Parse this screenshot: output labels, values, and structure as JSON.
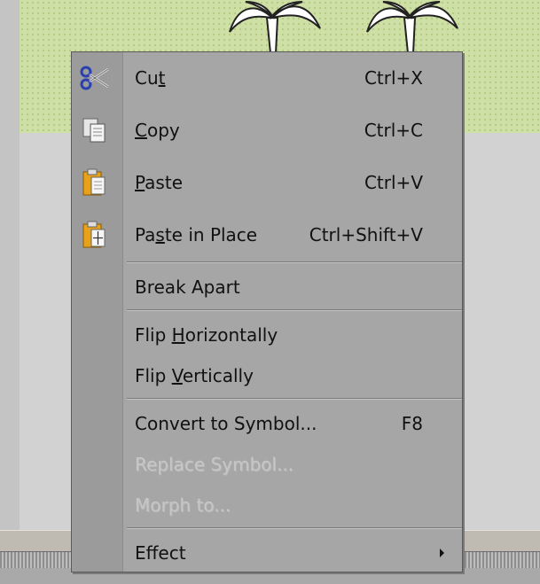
{
  "context_menu": {
    "cut": {
      "pre": "Cu",
      "key": "t",
      "post": "",
      "shortcut": "Ctrl+X"
    },
    "copy": {
      "pre": "",
      "key": "C",
      "post": "opy",
      "shortcut": "Ctrl+C"
    },
    "paste": {
      "pre": "",
      "key": "P",
      "post": "aste",
      "shortcut": "Ctrl+V"
    },
    "paste_in_place": {
      "pre": "Pa",
      "key": "s",
      "post": "te in Place",
      "shortcut": "Ctrl+Shift+V"
    },
    "break_apart": {
      "label": "Break Apart"
    },
    "flip_horizontally": {
      "pre": "Flip ",
      "key": "H",
      "post": "orizontally"
    },
    "flip_vertically": {
      "pre": "Flip ",
      "key": "V",
      "post": "ertically"
    },
    "convert_to_symbol": {
      "label": "Convert to Symbol...",
      "shortcut": "F8"
    },
    "replace_symbol": {
      "label": "Replace Symbol...",
      "enabled": false
    },
    "morph_to": {
      "label": "Morph to...",
      "enabled": false
    },
    "effect": {
      "label": "Effect",
      "has_submenu": true
    }
  },
  "icons": {
    "cut": "scissors-icon",
    "copy": "copy-icon",
    "paste": "paste-icon",
    "paste_in_place": "paste-in-place-icon"
  },
  "colors": {
    "canvas": "#cfe0a7",
    "menu_bg": "#a6a6a6",
    "menu_gutter": "#9b9b9b",
    "scissors": "#2a3fb0",
    "clipboard": "#e8a21a",
    "disabled_text": "#c6c6c6"
  }
}
